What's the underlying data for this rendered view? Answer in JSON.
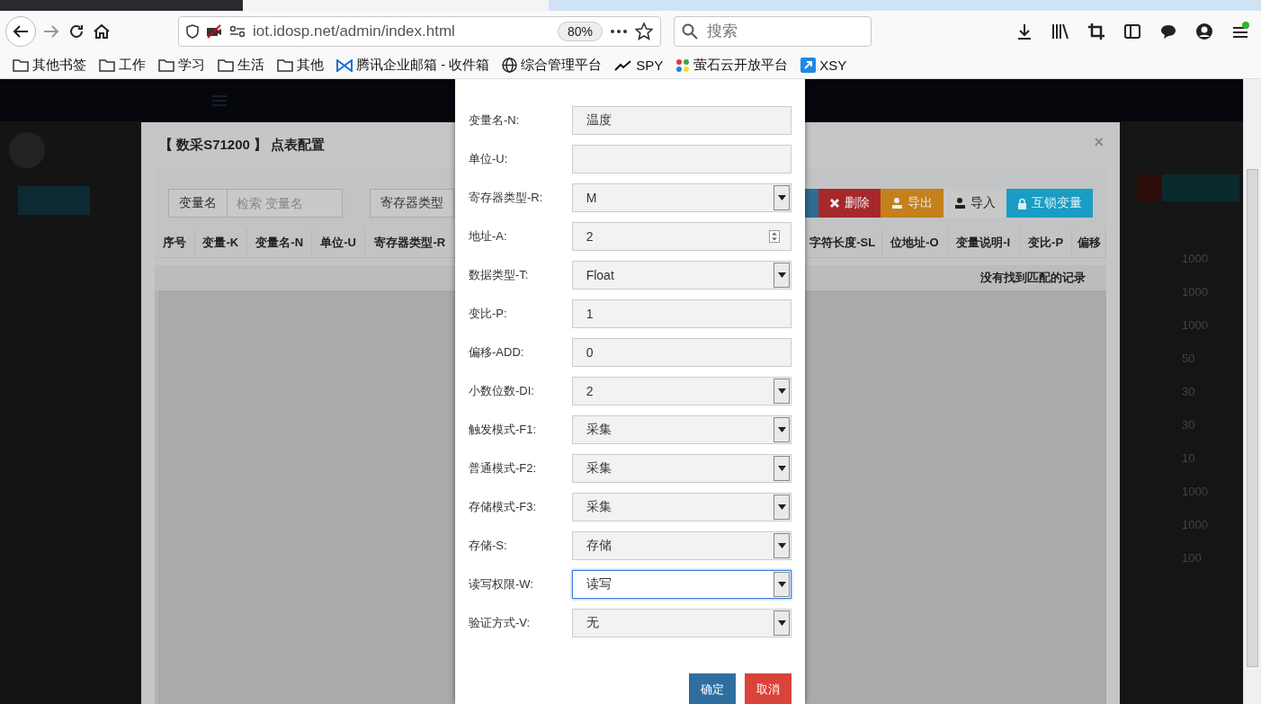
{
  "browser": {
    "url": "iot.idosp.net/admin/index.html",
    "zoom": "80%",
    "search_placeholder": "搜索",
    "bookmarks": [
      {
        "kind": "folder",
        "label": "其他书签"
      },
      {
        "kind": "folder",
        "label": "工作"
      },
      {
        "kind": "folder",
        "label": "学习"
      },
      {
        "kind": "folder",
        "label": "生活"
      },
      {
        "kind": "folder",
        "label": "其他"
      },
      {
        "kind": "mail",
        "label": "腾讯企业邮箱 - 收件箱"
      },
      {
        "kind": "globe",
        "label": "综合管理平台"
      },
      {
        "kind": "spy",
        "label": "SPY"
      },
      {
        "kind": "dots",
        "label": "萤石云开放平台"
      },
      {
        "kind": "arrow",
        "label": "XSY"
      }
    ]
  },
  "background_values": [
    "1000",
    "1000",
    "1000",
    "50",
    "30",
    "30",
    "10",
    "1000",
    "1000",
    "100"
  ],
  "modal": {
    "title": "【 数采S71200 】 点表配置",
    "close": "×",
    "search": {
      "label": "变量名",
      "placeholder": "检索 变量名"
    },
    "filter_button": "寄存器类型",
    "actions": [
      {
        "kind": "edge"
      },
      {
        "kind": "delete",
        "label": "删除"
      },
      {
        "kind": "export",
        "label": "导出"
      },
      {
        "kind": "import",
        "label": "导入"
      },
      {
        "kind": "lock",
        "label": "互锁变量"
      }
    ],
    "columns_left": [
      "序号",
      "变量-K",
      "变量名-N",
      "单位-U",
      "寄存器类型-R"
    ],
    "columns_right": [
      "字符长度-SL",
      "位地址-O",
      "变量说明-I",
      "变比-P",
      "偏移"
    ],
    "empty_message": "没有找到匹配的记录"
  },
  "dialog": {
    "fields": [
      {
        "label": "变量名-N:",
        "kind": "text",
        "value": "温度",
        "focused": false
      },
      {
        "label": "单位-U:",
        "kind": "text",
        "focused": false
      },
      {
        "label": "寄存器类型-R:",
        "kind": "select",
        "value": "M",
        "focused": false
      },
      {
        "label": "地址-A:",
        "kind": "number",
        "value": "2",
        "focused": false
      },
      {
        "label": "数据类型-T:",
        "kind": "select",
        "value": "Float",
        "focused": false
      },
      {
        "label": "变比-P:",
        "kind": "text",
        "value": "1",
        "focused": false
      },
      {
        "label": "偏移-ADD:",
        "kind": "text",
        "value": "0",
        "focused": false
      },
      {
        "label": "小数位数-DI:",
        "kind": "select",
        "value": "2",
        "focused": false
      },
      {
        "label": "触发模式-F1:",
        "kind": "select",
        "value": "采集",
        "focused": false
      },
      {
        "label": "普通模式-F2:",
        "kind": "select",
        "value": "采集",
        "focused": false
      },
      {
        "label": "存储模式-F3:",
        "kind": "select",
        "value": "采集",
        "focused": false
      },
      {
        "label": "存储-S:",
        "kind": "select",
        "value": "存储",
        "focused": false
      },
      {
        "label": "读写权限-W:",
        "kind": "select",
        "value": "读写",
        "focused": true
      },
      {
        "label": "验证方式-V:",
        "kind": "select",
        "value": "无",
        "focused": false
      }
    ],
    "buttons": [
      {
        "kind": "primary",
        "label": "确定"
      },
      {
        "kind": "danger",
        "label": "取消"
      }
    ]
  }
}
